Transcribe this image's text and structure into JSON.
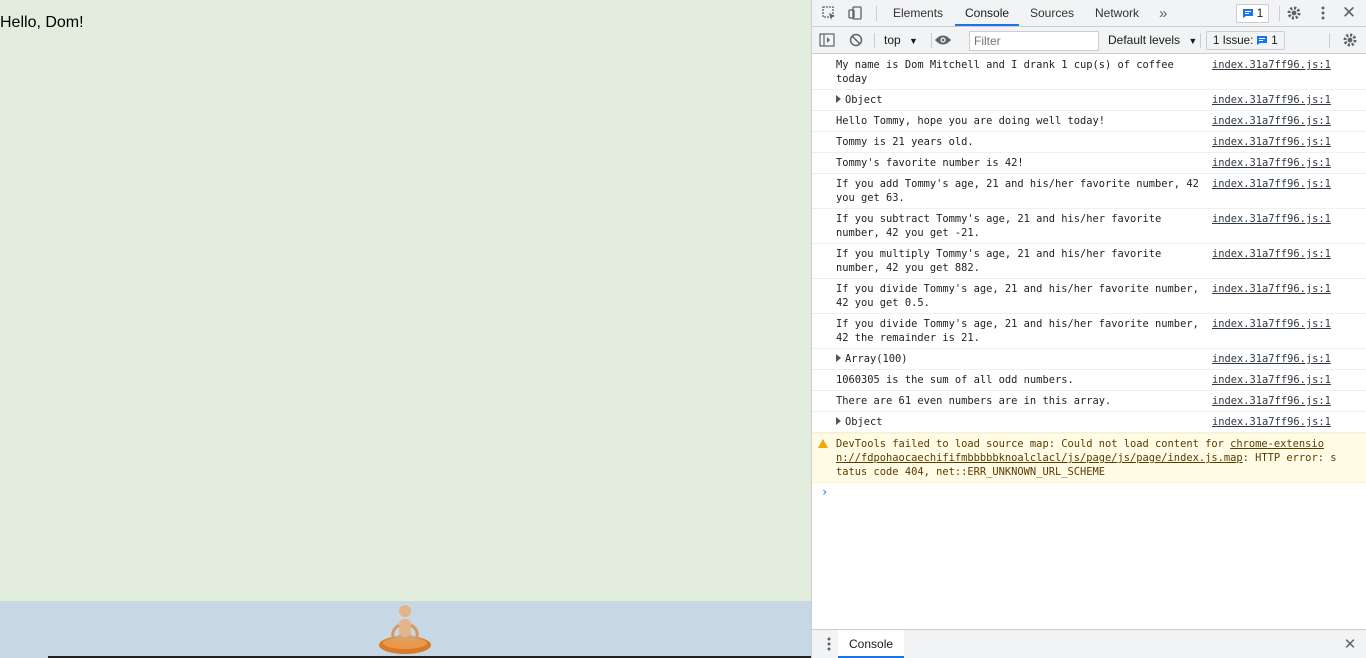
{
  "page": {
    "greeting": "Hello, Dom!"
  },
  "devtools": {
    "tabs": [
      "Elements",
      "Console",
      "Sources",
      "Network"
    ],
    "active_tab": "Console",
    "more_tabs_glyph": "»",
    "issues_count": "1",
    "toolbar": {
      "context": "top",
      "filter_placeholder": "Filter",
      "levels": "Default levels",
      "issue_label": "1 Issue:",
      "issue_count": "1"
    },
    "console_rows": [
      {
        "msg": "My name is Dom Mitchell and I drank 1 cup(s) of coffee today",
        "src": "index.31a7ff96.js:1"
      },
      {
        "msg": "Object",
        "src": "index.31a7ff96.js:1",
        "expandable": true
      },
      {
        "msg": "Hello Tommy, hope you are doing well today!",
        "src": "index.31a7ff96.js:1"
      },
      {
        "msg": "Tommy is 21 years old.",
        "src": "index.31a7ff96.js:1"
      },
      {
        "msg": "Tommy's favorite number is 42!",
        "src": "index.31a7ff96.js:1"
      },
      {
        "msg": "If you add Tommy's age, 21 and his/her favorite number, 42 you get 63.",
        "src": "index.31a7ff96.js:1"
      },
      {
        "msg": "If you subtract Tommy's age, 21 and his/her favorite number, 42 you get -21.",
        "src": "index.31a7ff96.js:1"
      },
      {
        "msg": "If you multiply Tommy's age, 21 and his/her favorite number, 42 you get 882.",
        "src": "index.31a7ff96.js:1"
      },
      {
        "msg": "If you divide Tommy's age, 21 and his/her favorite number, 42 you get 0.5.",
        "src": "index.31a7ff96.js:1"
      },
      {
        "msg": "If you divide Tommy's age, 21 and his/her favorite number, 42 the remainder is 21.",
        "src": "index.31a7ff96.js:1"
      },
      {
        "msg": "Array(100)",
        "src": "index.31a7ff96.js:1",
        "expandable": true
      },
      {
        "msg": "1060305 is the sum of all odd numbers.",
        "src": "index.31a7ff96.js:1"
      },
      {
        "msg": "There are 61 even numbers are in this array.",
        "src": "index.31a7ff96.js:1"
      },
      {
        "msg": "Object",
        "src": "index.31a7ff96.js:1",
        "expandable": true
      }
    ],
    "warning": {
      "prefix": "DevTools failed to load source map: Could not load content for ",
      "link": "chrome-extension://fdpohaocaechififmbbbbbknoalclacl/js/page/js/page/index.js.map",
      "suffix": ": HTTP error: status code 404, net::ERR_UNKNOWN_URL_SCHEME"
    },
    "prompt": "›",
    "drawer_tab": "Console",
    "close_glyph": "✕"
  },
  "colors": {
    "page_bg": "#e2eddd",
    "footer_bg": "#c7d8e4",
    "accent": "#1a73e8",
    "warning_bg": "#fffbe5"
  }
}
